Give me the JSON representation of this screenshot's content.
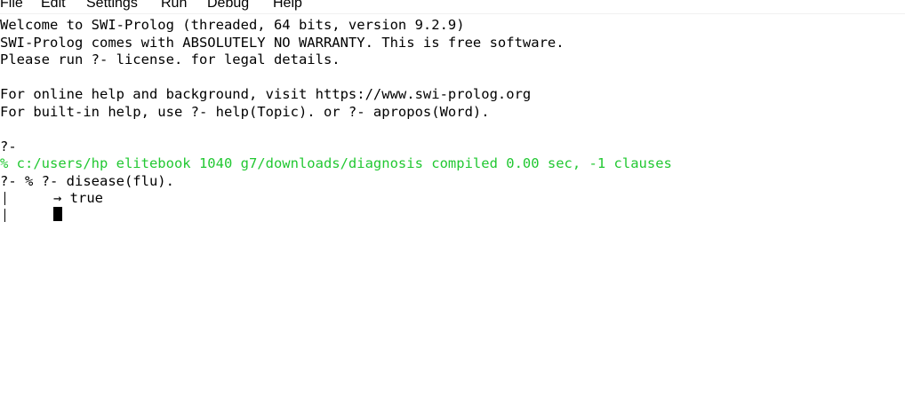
{
  "menu": {
    "items": [
      {
        "label": "File"
      },
      {
        "label": "Edit"
      },
      {
        "label": "Settings"
      },
      {
        "label": "Run"
      },
      {
        "label": "Debug"
      },
      {
        "label": "Help"
      }
    ]
  },
  "console": {
    "lines": [
      "Welcome to SWI-Prolog (threaded, 64 bits, version 9.2.9)",
      "SWI-Prolog comes with ABSOLUTELY NO WARRANTY. This is free software.",
      "Please run ?- license. for legal details.",
      "For online help and background, visit https://www.swi-prolog.org",
      "For built-in help, use ?- help(Topic). or ?- apropos(Word).",
      "?-",
      "% c:/users/hp elitebook 1040 g7/downloads/diagnosis compiled 0.00 sec, -1 clauses",
      "?- % ?- disease(flu).",
      "→ true"
    ]
  },
  "colors": {
    "compiled_message": "#22c832",
    "text": "#000000",
    "background": "#ffffff"
  }
}
